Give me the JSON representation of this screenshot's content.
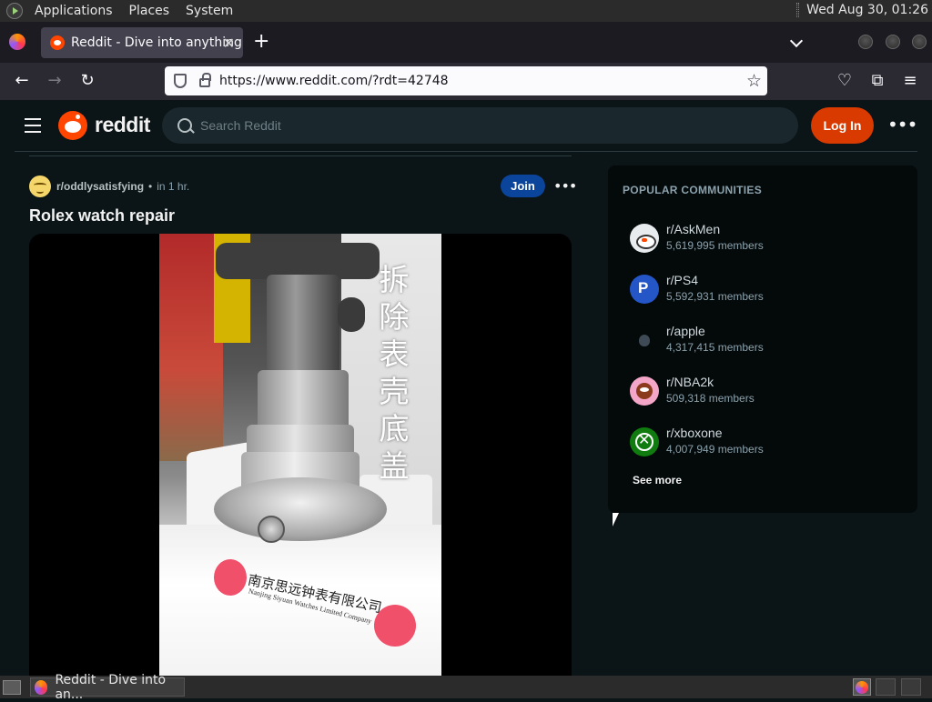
{
  "panel": {
    "menus": [
      "Applications",
      "Places",
      "System"
    ],
    "clock": "Wed Aug 30, 01:26"
  },
  "browser": {
    "tab_title": "Reddit - Dive into anything",
    "tab_close": "✕",
    "new_tab": "+",
    "url": "https://www.reddit.com/?rdt=42748",
    "icons": {
      "back": "←",
      "forward": "→",
      "reload": "↻",
      "star": "☆",
      "pocket": "♡",
      "extensions": "⧉",
      "menu": "≡"
    }
  },
  "reddit": {
    "wordmark": "reddit",
    "search_placeholder": "Search Reddit",
    "login_label": "Log In",
    "more_label": "•••",
    "post": {
      "subreddit": "r/oddlysatisfying",
      "separator": "•",
      "time": "in 1 hr.",
      "join_label": "Join",
      "more_label": "•••",
      "title": "Rolex watch repair",
      "video_caption": "拆除表壳底盖",
      "company_cn": "南京思远钟表有限公司",
      "company_en": "Nanjing Siyuan Watches Limited Company"
    },
    "sidebar": {
      "heading": "POPULAR COMMUNITIES",
      "communities": [
        {
          "name": "r/AskMen",
          "members": "5,619,995 members",
          "icon": "askmen-icon"
        },
        {
          "name": "r/PS4",
          "members": "5,592,931 members",
          "icon": "playstation-icon"
        },
        {
          "name": "r/apple",
          "members": "4,317,415 members",
          "icon": "apple-icon"
        },
        {
          "name": "r/NBA2k",
          "members": "509,318 members",
          "icon": "nba2k-icon"
        },
        {
          "name": "r/xboxone",
          "members": "4,007,949 members",
          "icon": "xbox-icon"
        }
      ],
      "see_more": "See more"
    }
  },
  "taskbar": {
    "task_label": "Reddit - Dive into an..."
  },
  "colors": {
    "page_bg": "#0b1416",
    "accent_orange": "#ff4500",
    "login_bg": "#d93a00",
    "join_bg": "#0a449b"
  }
}
